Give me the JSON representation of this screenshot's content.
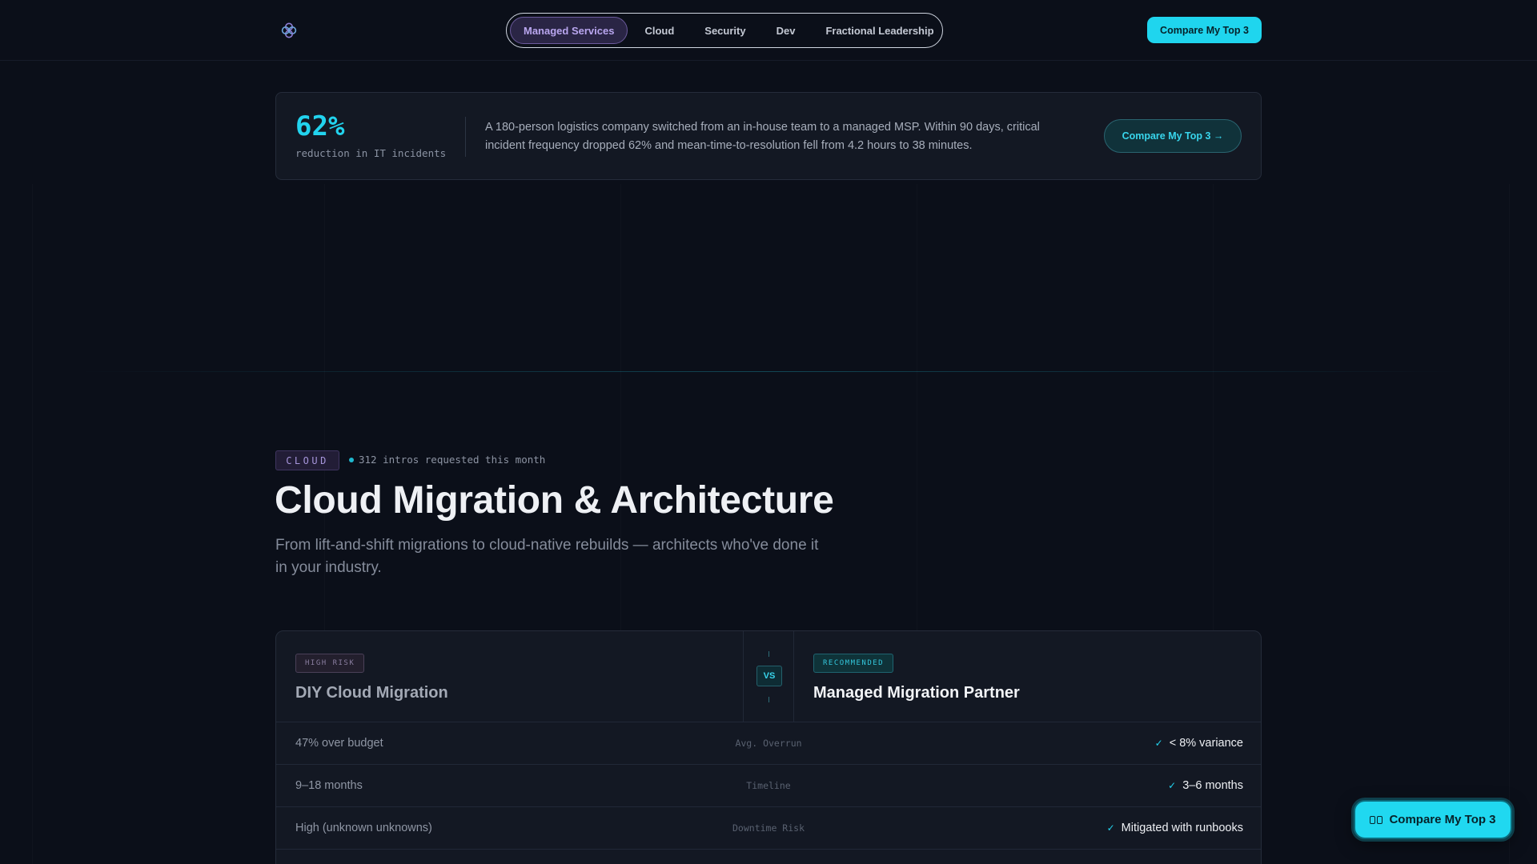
{
  "nav": {
    "items": [
      {
        "label": "Managed Services",
        "active": true
      },
      {
        "label": "Cloud",
        "active": false
      },
      {
        "label": "Security",
        "active": false
      },
      {
        "label": "Dev",
        "active": false
      },
      {
        "label": "Fractional Leadership",
        "active": false
      }
    ],
    "cta": "Compare My Top 3",
    "logo_icon": "flower-logo-icon"
  },
  "stat": {
    "value": "62%",
    "label": "reduction in IT incidents",
    "text": "A 180-person logistics company switched from an in-house team to a managed MSP. Within 90 days, critical incident frequency dropped 62% and mean-time-to-resolution fell from 4.2 hours to 38 minutes.",
    "cta": "Compare My Top 3 →"
  },
  "section": {
    "badge": "CLOUD",
    "live_text": "312 intros requested this month",
    "title": "Cloud Migration & Architecture",
    "subtitle": "From lift-and-shift migrations to cloud-native rebuilds — architects who've done it in your industry."
  },
  "comparison": {
    "left": {
      "tag": "HIGH RISK",
      "title": "DIY Cloud Migration"
    },
    "vs": "VS",
    "right": {
      "tag": "RECOMMENDED",
      "title": "Managed Migration Partner"
    },
    "rows": [
      {
        "left": "47% over budget",
        "metric": "Avg. Overrun",
        "right": "< 8% variance"
      },
      {
        "left": "9–18 months",
        "metric": "Timeline",
        "right": "3–6 months"
      },
      {
        "left": "High (unknown unknowns)",
        "metric": "Downtime Risk",
        "right": "Mitigated with runbooks"
      }
    ],
    "check_symbol": "✓"
  },
  "floating_cta": {
    "label": "Compare My Top 3",
    "icon": "compare-icon"
  },
  "colors": {
    "accent": "#22d3ee",
    "purple": "#a796dc",
    "background": "#0b0f19"
  }
}
